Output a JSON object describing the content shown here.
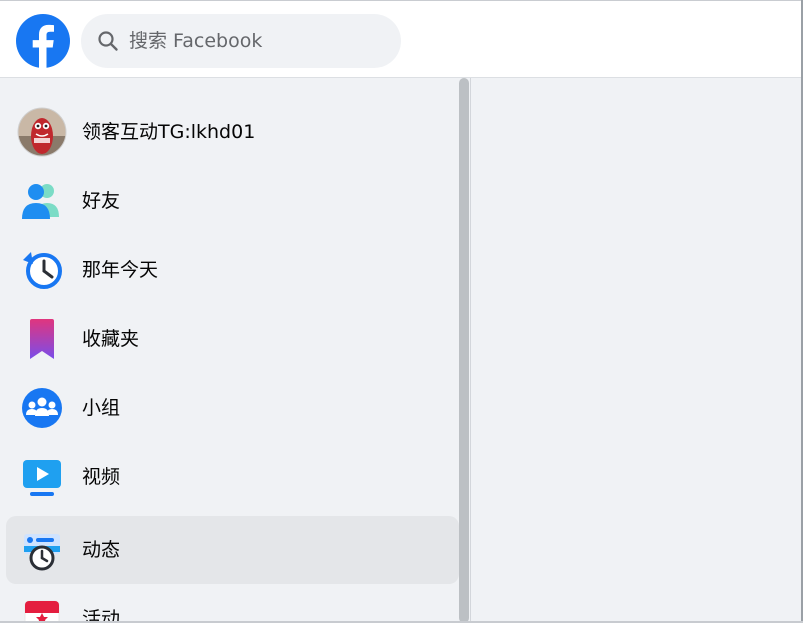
{
  "header": {
    "logo_icon": "facebook-logo-icon",
    "search_icon": "search-icon",
    "search_placeholder": "搜索 Facebook",
    "brand_color": "#1877f2"
  },
  "sidebar": {
    "items": [
      {
        "label": "领客互动TG:lkhd01",
        "icon": "avatar-icon"
      },
      {
        "label": "好友",
        "icon": "friends-icon"
      },
      {
        "label": "那年今天",
        "icon": "memories-clock-icon"
      },
      {
        "label": "收藏夹",
        "icon": "bookmark-icon"
      },
      {
        "label": "小组",
        "icon": "groups-icon"
      },
      {
        "label": "视频",
        "icon": "video-icon"
      },
      {
        "label": "动态",
        "icon": "feeds-icon",
        "active": true
      },
      {
        "label": "活动",
        "icon": "calendar-icon"
      }
    ]
  }
}
